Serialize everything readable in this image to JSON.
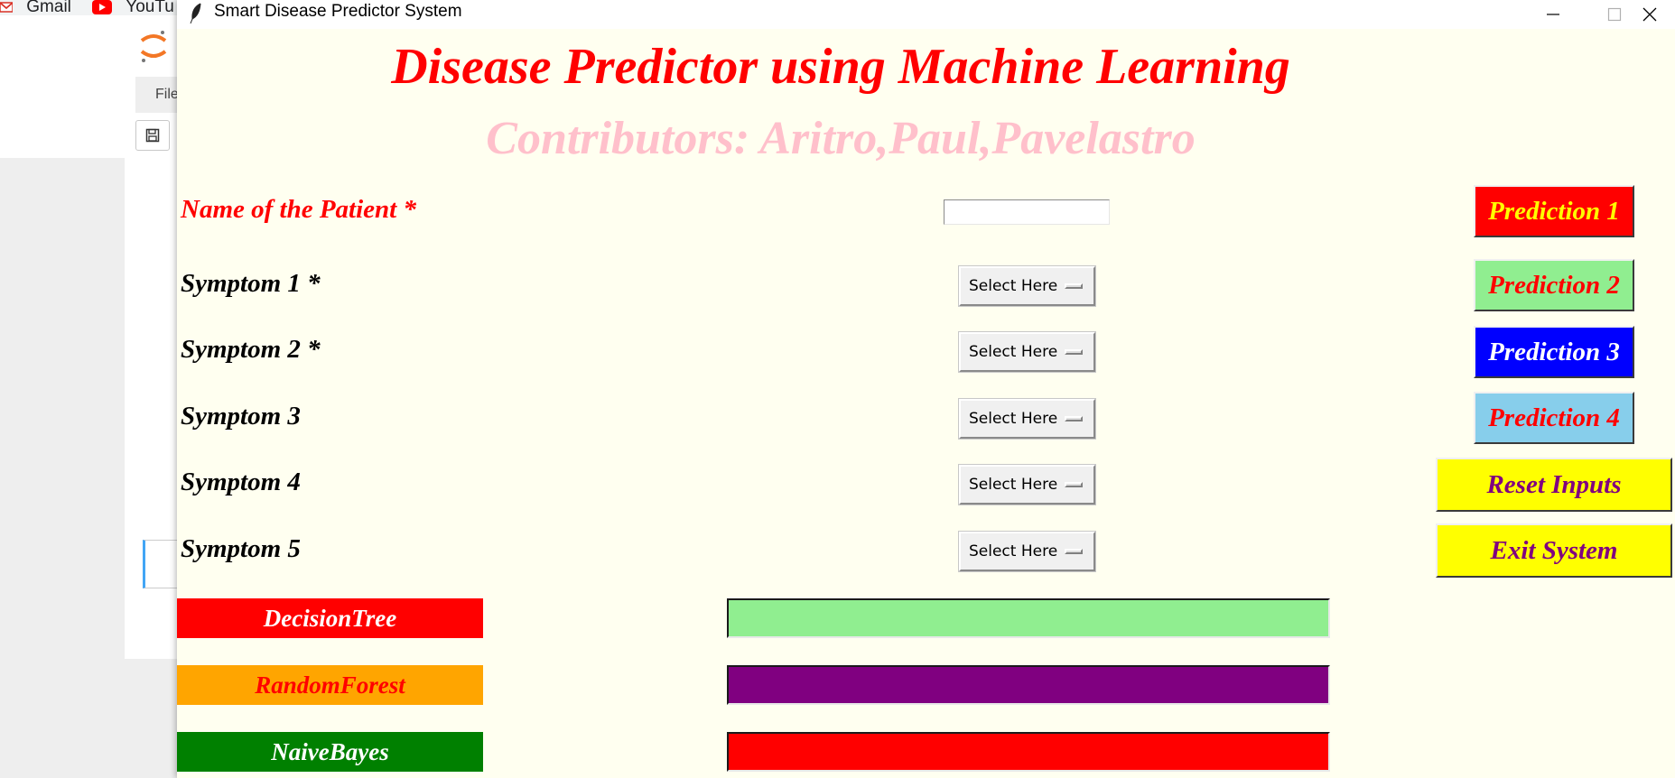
{
  "background": {
    "bookmarks": [
      {
        "label": "Gmail",
        "icon": "gmail-icon"
      },
      {
        "label": "YouTu",
        "icon": "youtube-icon"
      }
    ],
    "file_menu_label": "File"
  },
  "window": {
    "title": "Smart Disease Predictor System",
    "icon": "feather-icon"
  },
  "header": {
    "title": "Disease Predictor using Machine Learning",
    "contributors": "Contributors: Aritro,Paul,Pavelastro"
  },
  "form": {
    "patient_label": "Name of the Patient *",
    "patient_value": "",
    "symptoms": [
      {
        "label": "Symptom 1 *",
        "selected": "Select Here"
      },
      {
        "label": "Symptom 2 *",
        "selected": "Select Here"
      },
      {
        "label": "Symptom 3",
        "selected": "Select Here"
      },
      {
        "label": "Symptom 4",
        "selected": "Select Here"
      },
      {
        "label": "Symptom 5",
        "selected": "Select Here"
      }
    ]
  },
  "buttons": {
    "prediction_1": {
      "label": "Prediction 1",
      "bg": "#ff0000",
      "fg": "#ffff00"
    },
    "prediction_2": {
      "label": "Prediction 2",
      "bg": "#90ee90",
      "fg": "#ff0000"
    },
    "prediction_3": {
      "label": "Prediction 3",
      "bg": "#0000ff",
      "fg": "#ffffff"
    },
    "prediction_4": {
      "label": "Prediction 4",
      "bg": "#87ceeb",
      "fg": "#ff0000"
    },
    "reset": {
      "label": "Reset Inputs",
      "bg": "#ffff00",
      "fg": "#800080"
    },
    "exit": {
      "label": "Exit System",
      "bg": "#ffff00",
      "fg": "#800080"
    }
  },
  "algorithms": [
    {
      "label": "DecisionTree",
      "bg": "#ff0000",
      "fg": "#ffffff",
      "result": "",
      "result_bg": "#90ee90"
    },
    {
      "label": "RandomForest",
      "bg": "#ffa500",
      "fg": "#ff0000",
      "result": "",
      "result_bg": "#800080"
    },
    {
      "label": "NaiveBayes",
      "bg": "#008000",
      "fg": "#ffffff",
      "result": "",
      "result_bg": "#ff0000"
    }
  ]
}
